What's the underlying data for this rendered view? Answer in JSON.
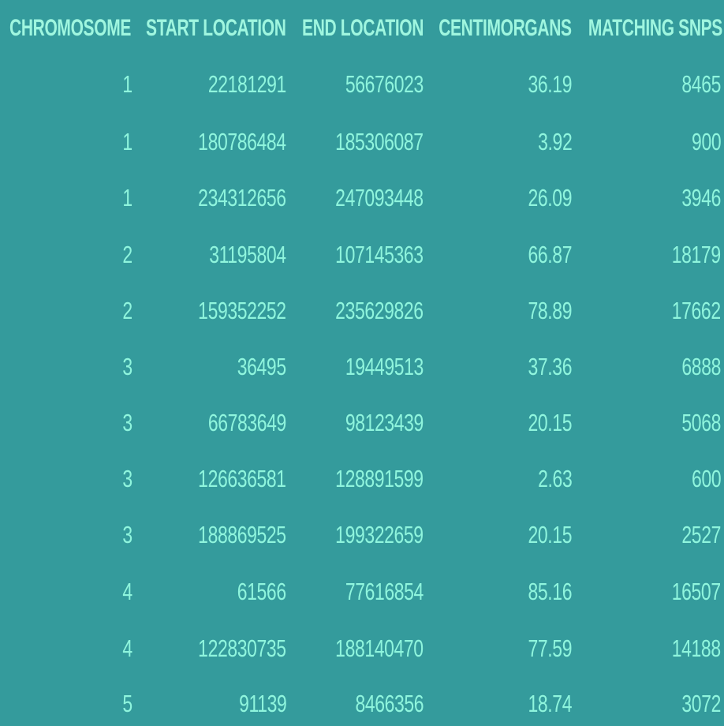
{
  "table": {
    "headers": [
      "CHROMOSOME",
      "START LOCATION",
      "END LOCATION",
      "CENTIMORGANS",
      "MATCHING SNPS"
    ],
    "rows": [
      [
        "1",
        "22181291",
        "56676023",
        "36.19",
        "8465"
      ],
      [
        "1",
        "180786484",
        "185306087",
        "3.92",
        "900"
      ],
      [
        "1",
        "234312656",
        "247093448",
        "26.09",
        "3946"
      ],
      [
        "2",
        "31195804",
        "107145363",
        "66.87",
        "18179"
      ],
      [
        "2",
        "159352252",
        "235629826",
        "78.89",
        "17662"
      ],
      [
        "3",
        "36495",
        "19449513",
        "37.36",
        "6888"
      ],
      [
        "3",
        "66783649",
        "98123439",
        "20.15",
        "5068"
      ],
      [
        "3",
        "126636581",
        "128891599",
        "2.63",
        "600"
      ],
      [
        "3",
        "188869525",
        "199322659",
        "20.15",
        "2527"
      ],
      [
        "4",
        "61566",
        "77616854",
        "85.16",
        "16507"
      ],
      [
        "4",
        "122830735",
        "188140470",
        "77.59",
        "14188"
      ],
      [
        "5",
        "91139",
        "8466356",
        "18.74",
        "3072"
      ]
    ]
  },
  "colors": {
    "background": "#349b9c",
    "text": "#8ff5dd"
  }
}
